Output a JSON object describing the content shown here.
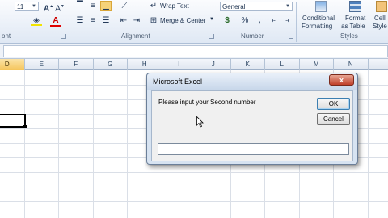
{
  "ribbon": {
    "font_size": "11",
    "font_group_label": "ont",
    "wrap_text": "Wrap Text",
    "merge_center": "Merge & Center",
    "alignment_label": "Alignment",
    "number_format": "General",
    "number_label": "Number",
    "conditional_formatting": [
      "Conditional",
      "Formatting"
    ],
    "format_as_table": [
      "Format",
      "as Table"
    ],
    "cell_styles": [
      "Cell",
      "Style"
    ],
    "styles_label": "Styles",
    "currency_symbol": "$",
    "percent_symbol": "%",
    "comma_symbol": ","
  },
  "columns": [
    "D",
    "E",
    "F",
    "G",
    "H",
    "I",
    "J",
    "K",
    "L",
    "M",
    "N"
  ],
  "selected_column": "D",
  "dialog": {
    "title": "Microsoft Excel",
    "close_glyph": "x",
    "prompt": "Please input your Second number",
    "ok_label": "OK",
    "cancel_label": "Cancel",
    "input_value": ""
  },
  "colors": {
    "selected_header": "#f5c55b",
    "dialog_frame": "#d7e3f1",
    "close_button": "#c0402a"
  }
}
